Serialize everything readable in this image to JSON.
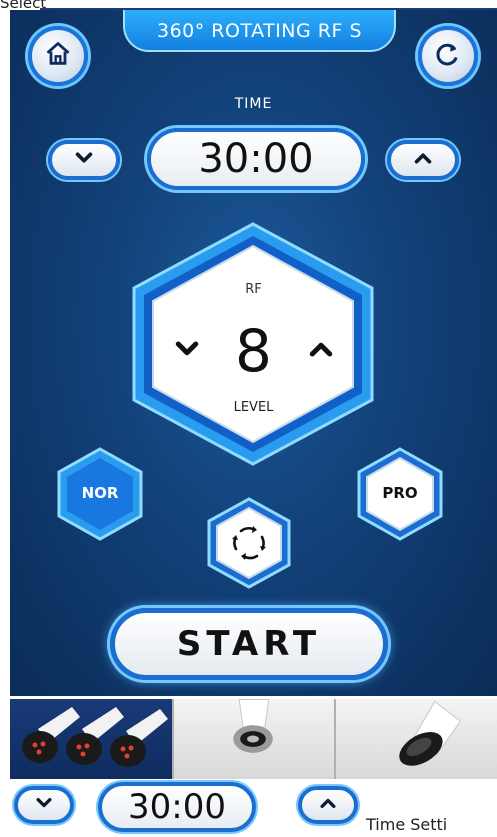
{
  "page": {
    "top_label": "Select",
    "caption": "Time Setti"
  },
  "header": {
    "title": "360° ROTATING RF S"
  },
  "icons": {
    "home": "home-icon",
    "refresh": "refresh-icon",
    "down": "chevron-down-icon",
    "up": "chevron-up-icon",
    "rotate": "rotation-arrows-icon"
  },
  "time": {
    "label": "TIME",
    "value": "30:00"
  },
  "rf": {
    "label": "RF",
    "level": "8",
    "level_label": "LEVEL"
  },
  "modes": {
    "normal": "NOR",
    "pro": "PRO"
  },
  "start": {
    "label": "START"
  },
  "probes": [
    {
      "name": "triple-ball-probe"
    },
    {
      "name": "ring-probe"
    },
    {
      "name": "cone-probe"
    }
  ],
  "bottom_time": {
    "value": "30:00"
  },
  "colors": {
    "accent": "#1b6ed0",
    "glow": "#74c8ff",
    "background": "#124078",
    "title_pill": "#1f95f0"
  }
}
